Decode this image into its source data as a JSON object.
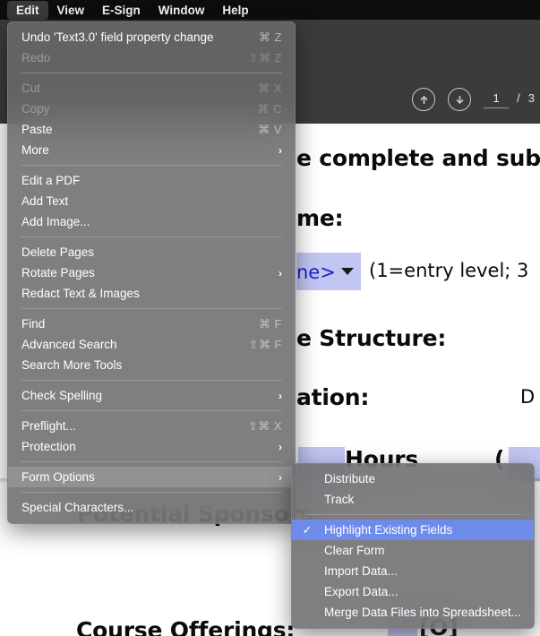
{
  "menubar": {
    "items": [
      {
        "label": "Edit",
        "active": true
      },
      {
        "label": "View",
        "active": false
      },
      {
        "label": "E-Sign",
        "active": false
      },
      {
        "label": "Window",
        "active": false
      },
      {
        "label": "Help",
        "active": false
      }
    ]
  },
  "toolbar": {
    "prev_page_icon": "arrow-up-circle-icon",
    "next_page_icon": "arrow-down-circle-icon",
    "current_page": "1",
    "page_separator": "/",
    "total_pages": "3"
  },
  "edit_menu": {
    "groups": [
      {
        "items": [
          {
            "label": "Undo 'Text3.0' field property change",
            "shortcut": "⌘ Z",
            "disabled": false,
            "submenu": false,
            "highlighted": false
          },
          {
            "label": "Redo",
            "shortcut": "⇧⌘ Z",
            "disabled": true,
            "submenu": false,
            "highlighted": false
          }
        ]
      },
      {
        "items": [
          {
            "label": "Cut",
            "shortcut": "⌘ X",
            "disabled": true,
            "submenu": false,
            "highlighted": false
          },
          {
            "label": "Copy",
            "shortcut": "⌘ C",
            "disabled": true,
            "submenu": false,
            "highlighted": false
          },
          {
            "label": "Paste",
            "shortcut": "⌘ V",
            "disabled": false,
            "submenu": false,
            "highlighted": false
          },
          {
            "label": "More",
            "shortcut": "",
            "disabled": false,
            "submenu": true,
            "highlighted": false
          }
        ]
      },
      {
        "items": [
          {
            "label": "Edit a PDF",
            "shortcut": "",
            "disabled": false,
            "submenu": false,
            "highlighted": false
          },
          {
            "label": "Add Text",
            "shortcut": "",
            "disabled": false,
            "submenu": false,
            "highlighted": false
          },
          {
            "label": "Add Image...",
            "shortcut": "",
            "disabled": false,
            "submenu": false,
            "highlighted": false
          }
        ]
      },
      {
        "items": [
          {
            "label": "Delete Pages",
            "shortcut": "",
            "disabled": false,
            "submenu": false,
            "highlighted": false
          },
          {
            "label": "Rotate Pages",
            "shortcut": "",
            "disabled": false,
            "submenu": true,
            "highlighted": false
          },
          {
            "label": "Redact Text & Images",
            "shortcut": "",
            "disabled": false,
            "submenu": false,
            "highlighted": false
          }
        ]
      },
      {
        "items": [
          {
            "label": "Find",
            "shortcut": "⌘ F",
            "disabled": false,
            "submenu": false,
            "highlighted": false
          },
          {
            "label": "Advanced Search",
            "shortcut": "⇧⌘ F",
            "disabled": false,
            "submenu": false,
            "highlighted": false
          },
          {
            "label": "Search More Tools",
            "shortcut": "",
            "disabled": false,
            "submenu": false,
            "highlighted": false
          }
        ]
      },
      {
        "items": [
          {
            "label": "Check Spelling",
            "shortcut": "",
            "disabled": false,
            "submenu": true,
            "highlighted": false
          }
        ]
      },
      {
        "items": [
          {
            "label": "Preflight...",
            "shortcut": "⇧⌘ X",
            "disabled": false,
            "submenu": false,
            "highlighted": false
          },
          {
            "label": "Protection",
            "shortcut": "",
            "disabled": false,
            "submenu": true,
            "highlighted": false
          }
        ]
      },
      {
        "items": [
          {
            "label": "Form Options",
            "shortcut": "",
            "disabled": false,
            "submenu": true,
            "highlighted": true
          }
        ]
      },
      {
        "items": [
          {
            "label": "Special Characters...",
            "shortcut": "",
            "disabled": false,
            "submenu": false,
            "highlighted": false
          }
        ]
      }
    ]
  },
  "form_submenu": {
    "groups": [
      {
        "items": [
          {
            "label": "Distribute",
            "checked": false,
            "selected": false
          },
          {
            "label": "Track",
            "checked": false,
            "selected": false
          }
        ]
      },
      {
        "items": [
          {
            "label": "Highlight Existing Fields",
            "checked": true,
            "selected": true
          },
          {
            "label": "Clear Form",
            "checked": false,
            "selected": false
          },
          {
            "label": "Import Data...",
            "checked": false,
            "selected": false
          },
          {
            "label": "Export Data...",
            "checked": false,
            "selected": false
          },
          {
            "label": "Merge Data Files into Spreadsheet...",
            "checked": false,
            "selected": false
          }
        ]
      }
    ]
  },
  "document": {
    "lines": [
      {
        "text": "e complete and subm",
        "kind": "heading"
      },
      {
        "text": "me:",
        "kind": "heading"
      },
      {
        "text": "(1=entry level; 3",
        "kind": "body"
      },
      {
        "text": "e Structure:",
        "kind": "heading"
      },
      {
        "text": "ation:",
        "kind": "heading"
      },
      {
        "text": "D",
        "kind": "body"
      },
      {
        "text": "Hours",
        "kind": "heading"
      },
      {
        "text": "(",
        "kind": "heading"
      },
      {
        "text": "Potential Sponsors:",
        "kind": "heading"
      },
      {
        "text": "Course Offerings:",
        "kind": "heading"
      },
      {
        "text": "[O]",
        "kind": "heading"
      }
    ],
    "field_value": "ne>",
    "field_highlight_color": "#c2c6f2"
  },
  "colors": {
    "menubar_bg": "#0d0d0d",
    "menu_bg": "#6a6a6c",
    "selection_blue": "#6f8bea",
    "toolbar_bg": "#3b3b3b",
    "field_highlight": "#c2c6f2"
  }
}
